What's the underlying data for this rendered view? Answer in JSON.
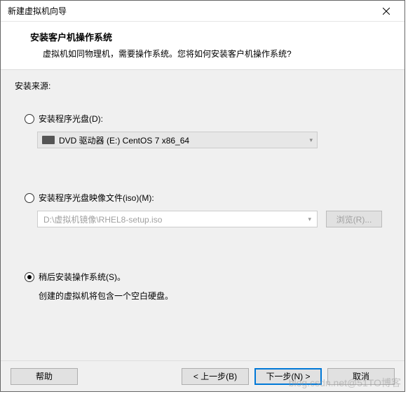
{
  "window": {
    "title": "新建虚拟机向导"
  },
  "header": {
    "title": "安装客户机操作系统",
    "desc": "虚拟机如同物理机，需要操作系统。您将如何安装客户机操作系统?"
  },
  "source": {
    "label": "安装来源:"
  },
  "option_disc": {
    "label": "安装程序光盘(D):",
    "value": "DVD 驱动器 (E:) CentOS 7 x86_64"
  },
  "option_iso": {
    "label": "安装程序光盘映像文件(iso)(M):",
    "path": "D:\\虚拟机镜像\\RHEL8-setup.iso",
    "browse": "浏览(R)..."
  },
  "option_later": {
    "label": "稍后安装操作系统(S)。",
    "desc": "创建的虚拟机将包含一个空白硬盘。"
  },
  "footer": {
    "help": "帮助",
    "back": "< 上一步(B)",
    "next": "下一步(N) >",
    "cancel": "取消"
  },
  "watermark": "blog.csdn.net@51TO博客"
}
